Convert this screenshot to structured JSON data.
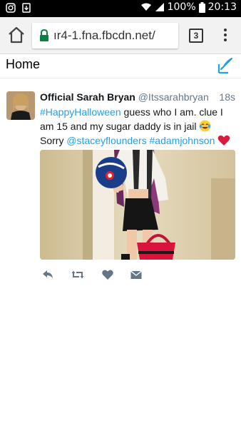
{
  "status_bar": {
    "battery_percent": "100%",
    "time": "20:13",
    "icons": [
      "instagram-icon",
      "download-icon",
      "wifi-icon",
      "signal-icon",
      "battery-icon"
    ]
  },
  "browser": {
    "url": "ır4-1.fna.fbcdn.net/",
    "tab_count": "3",
    "colors": {
      "lock": "#0b8043",
      "toolbar": "#f2f2f2"
    }
  },
  "page": {
    "title": "Home"
  },
  "tweet": {
    "author_name": "Official Sarah Bryan",
    "author_handle": "@Itssarahbryan",
    "time": "18s",
    "text": {
      "hashtag1": "#HappyHalloween",
      "part1": " guess who I am. clue I am 15 and my sugar daddy is in jail ",
      "part2": " Sorry ",
      "mention": "@staceyflounders",
      "hashtag2": "#adamjohnson"
    },
    "emojis": [
      "face-with-tears-of-joy",
      "red-heart"
    ],
    "actions": [
      "reply-icon",
      "retweet-icon",
      "like-icon",
      "message-icon"
    ]
  },
  "colors": {
    "accent": "#1da1f2",
    "text": "#14171a",
    "muted": "#657786"
  }
}
